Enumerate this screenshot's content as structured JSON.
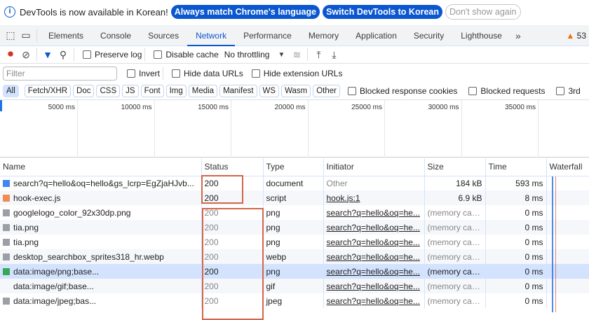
{
  "banner": {
    "message": "DevTools is now available in Korean!",
    "btn_match": "Always match Chrome's language",
    "btn_switch": "Switch DevTools to Korean",
    "btn_dismiss": "Don't show again"
  },
  "tabs": [
    "Elements",
    "Console",
    "Sources",
    "Network",
    "Performance",
    "Memory",
    "Application",
    "Security",
    "Lighthouse"
  ],
  "active_tab": "Network",
  "warnings": "53",
  "toolbar": {
    "preserve_log": "Preserve log",
    "disable_cache": "Disable cache",
    "throttling": "No throttling"
  },
  "filter": {
    "placeholder": "Filter",
    "invert": "Invert",
    "hide_data": "Hide data URLs",
    "hide_ext": "Hide extension URLs"
  },
  "types": [
    "All",
    "Fetch/XHR",
    "Doc",
    "CSS",
    "JS",
    "Font",
    "Img",
    "Media",
    "Manifest",
    "WS",
    "Wasm",
    "Other"
  ],
  "type_checks": [
    "Blocked response cookies",
    "Blocked requests",
    "3rd"
  ],
  "timeline_ticks": [
    "5000 ms",
    "10000 ms",
    "15000 ms",
    "20000 ms",
    "25000 ms",
    "30000 ms",
    "35000 ms",
    "40"
  ],
  "columns": [
    "Name",
    "Status",
    "Type",
    "Initiator",
    "Size",
    "Time",
    "Waterfall"
  ],
  "rows": [
    {
      "name": "search?q=hello&oq=hello&gs_lcrp=EgZjaHJvb...",
      "status": "200",
      "type": "document",
      "initiator": "Other",
      "size": "184 kB",
      "time": "593 ms",
      "icon": "document-icon"
    },
    {
      "name": "hook-exec.js",
      "status": "200",
      "type": "script",
      "initiator": "hook.js:1",
      "size": "6.9 kB",
      "time": "8 ms",
      "icon": "script-icon"
    },
    {
      "name": "googlelogo_color_92x30dp.png",
      "status": "200",
      "type": "png",
      "initiator": "search?q=hello&oq=he...",
      "size": "(memory cac...",
      "time": "0 ms",
      "icon": "image-icon"
    },
    {
      "name": "tia.png",
      "status": "200",
      "type": "png",
      "initiator": "search?q=hello&oq=he...",
      "size": "(memory cac...",
      "time": "0 ms",
      "icon": "image-icon"
    },
    {
      "name": "tia.png",
      "status": "200",
      "type": "png",
      "initiator": "search?q=hello&oq=he...",
      "size": "(memory cac...",
      "time": "0 ms",
      "icon": "image-icon"
    },
    {
      "name": "desktop_searchbox_sprites318_hr.webp",
      "status": "200",
      "type": "webp",
      "initiator": "search?q=hello&oq=he...",
      "size": "(memory cac...",
      "time": "0 ms",
      "icon": "image-icon"
    },
    {
      "name": "data:image/png;base...",
      "status": "200",
      "type": "png",
      "initiator": "search?q=hello&oq=he...",
      "size": "(memory cac...",
      "time": "0 ms",
      "icon": "image-icon"
    },
    {
      "name": "data:image/gif;base...",
      "status": "200",
      "type": "gif",
      "initiator": "search?q=hello&oq=he...",
      "size": "(memory cac...",
      "time": "0 ms",
      "icon": "image-icon"
    },
    {
      "name": "data:image/jpeg;bas...",
      "status": "200",
      "type": "jpeg",
      "initiator": "search?q=hello&oq=he...",
      "size": "(memory cac...",
      "time": "0 ms",
      "icon": "image-icon"
    }
  ]
}
